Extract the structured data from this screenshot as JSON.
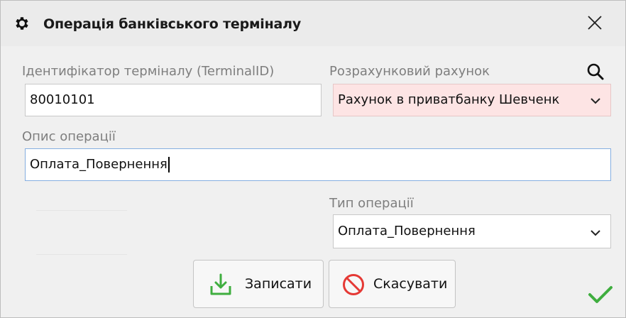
{
  "window": {
    "title": "Операція банківського терміналу",
    "title_icon": "gear-icon",
    "close_icon": "close-icon"
  },
  "fields": {
    "terminal_id": {
      "label": "Ідентифікатор терміналу (TerminalID)",
      "value": "80010101"
    },
    "account": {
      "label": "Розрахунковий рахунок",
      "value": "Рахунок в приватбанку Шевченк",
      "search_icon": "search-icon"
    },
    "description": {
      "label": "Опис операції",
      "value": "Оплата_Повернення"
    },
    "operation_type": {
      "label": "Тип операції",
      "value": "Оплата_Повернення"
    }
  },
  "buttons": {
    "save": {
      "label": "Записати",
      "icon": "download-save-icon"
    },
    "cancel": {
      "label": "Скасувати",
      "icon": "cancel-icon"
    }
  },
  "status": {
    "icon": "checkmark-icon"
  },
  "colors": {
    "title_bar": "#ebebeb",
    "window_bg": "#f0f0f0",
    "required_field_bg": "#fde4e4",
    "save_icon": "#3fae3f",
    "cancel_icon": "#e53935",
    "check_icon": "#3fae3f",
    "focus_border": "#85aee0"
  }
}
